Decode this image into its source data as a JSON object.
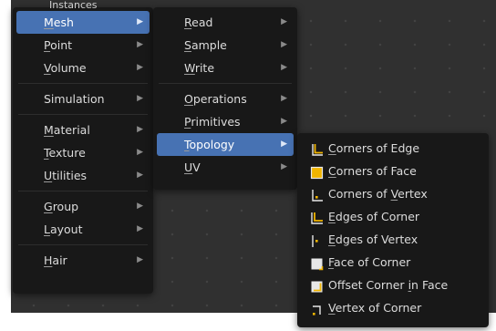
{
  "partial_item": "Instances",
  "main_menu": {
    "groups": [
      [
        {
          "pre": "",
          "u": "M",
          "post": "esh",
          "active": true
        },
        {
          "pre": "",
          "u": "P",
          "post": "oint",
          "active": false
        },
        {
          "pre": "",
          "u": "V",
          "post": "olume",
          "active": false
        }
      ],
      [
        {
          "pre": "",
          "u": "",
          "post": "Simulation",
          "active": false
        }
      ],
      [
        {
          "pre": "",
          "u": "M",
          "post": "aterial",
          "active": false
        },
        {
          "pre": "",
          "u": "T",
          "post": "exture",
          "active": false
        },
        {
          "pre": "",
          "u": "U",
          "post": "tilities",
          "active": false
        }
      ],
      [
        {
          "pre": "",
          "u": "G",
          "post": "roup",
          "active": false
        },
        {
          "pre": "",
          "u": "L",
          "post": "ayout",
          "active": false
        }
      ],
      [
        {
          "pre": "",
          "u": "H",
          "post": "air",
          "active": false
        }
      ]
    ]
  },
  "mesh_menu": {
    "groups": [
      [
        {
          "pre": "",
          "u": "R",
          "post": "ead",
          "active": false
        },
        {
          "pre": "",
          "u": "S",
          "post": "ample",
          "active": false
        },
        {
          "pre": "",
          "u": "W",
          "post": "rite",
          "active": false
        }
      ],
      [
        {
          "pre": "",
          "u": "O",
          "post": "perations",
          "active": false
        },
        {
          "pre": "",
          "u": "P",
          "post": "rimitives",
          "active": false
        },
        {
          "pre": "",
          "u": "T",
          "post": "opology",
          "active": true
        },
        {
          "pre": "",
          "u": "U",
          "post": "V",
          "active": false
        }
      ]
    ]
  },
  "topology_menu": {
    "items": [
      {
        "pre": "",
        "u": "C",
        "post": "orners of Edge",
        "icon": "corners-of-edge-icon"
      },
      {
        "pre": "",
        "u": "C",
        "post": "orners of Face",
        "icon": "corners-of-face-icon"
      },
      {
        "pre": "Corners of ",
        "u": "V",
        "post": "ertex",
        "icon": "corners-of-vertex-icon"
      },
      {
        "pre": "",
        "u": "E",
        "post": "dges of Corner",
        "icon": "edges-of-corner-icon"
      },
      {
        "pre": "",
        "u": "E",
        "post": "dges of Vertex",
        "icon": "edges-of-vertex-icon"
      },
      {
        "pre": "",
        "u": "F",
        "post": "ace of Corner",
        "icon": "face-of-corner-icon"
      },
      {
        "pre": "Offset Corner ",
        "u": "i",
        "post": "n Face",
        "icon": "offset-corner-in-face-icon"
      },
      {
        "pre": "",
        "u": "V",
        "post": "ertex of Corner",
        "icon": "vertex-of-corner-icon"
      }
    ]
  },
  "colors": {
    "highlight": "#4772b3",
    "accent_yellow": "#f0b400",
    "menu_bg": "#181818",
    "editor_bg": "#303030"
  }
}
